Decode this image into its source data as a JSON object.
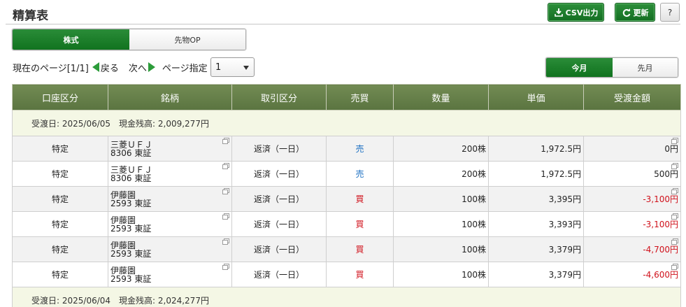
{
  "page": {
    "title": "精算表"
  },
  "toolbar": {
    "csv_label": "CSV出力",
    "refresh_label": "更新",
    "help_label": "?"
  },
  "product_tabs": [
    {
      "label": "株式",
      "selected": true
    },
    {
      "label": "先物OP",
      "selected": false
    }
  ],
  "pager": {
    "current_page_label": "現在のページ[1/1]",
    "prev_label": "戻る",
    "next_label": "次へ",
    "page_select_label": "ページ指定",
    "page_value": "1"
  },
  "period_tabs": [
    {
      "label": "今月",
      "selected": true
    },
    {
      "label": "先月",
      "selected": false
    }
  ],
  "colors": {
    "header": "#65804a",
    "sell": "#1b6fc2",
    "buy": "#d0111b",
    "negative": "#d0111b",
    "accent": "#1e7d2b"
  },
  "table": {
    "headers": [
      "口座区分",
      "銘柄",
      "取引区分",
      "売買",
      "数量",
      "単価",
      "受渡金額"
    ],
    "group1": {
      "label": "受渡日: 2025/06/05　現金残高: 2,009,277円"
    },
    "rows": [
      {
        "account": "特定",
        "name": "三菱ＵＦＪ",
        "code": "8306 東証",
        "type": "返済（一日）",
        "side": "売",
        "qty": "200株",
        "price": "1,972.5円",
        "amount": "0円"
      },
      {
        "account": "特定",
        "name": "三菱ＵＦＪ",
        "code": "8306 東証",
        "type": "返済（一日）",
        "side": "売",
        "qty": "200株",
        "price": "1,972.5円",
        "amount": "500円"
      },
      {
        "account": "特定",
        "name": "伊藤園",
        "code": "2593 東証",
        "type": "返済（一日）",
        "side": "買",
        "qty": "100株",
        "price": "3,395円",
        "amount": "-3,100円"
      },
      {
        "account": "特定",
        "name": "伊藤園",
        "code": "2593 東証",
        "type": "返済（一日）",
        "side": "買",
        "qty": "100株",
        "price": "3,393円",
        "amount": "-3,100円"
      },
      {
        "account": "特定",
        "name": "伊藤園",
        "code": "2593 東証",
        "type": "返済（一日）",
        "side": "買",
        "qty": "100株",
        "price": "3,379円",
        "amount": "-4,700円"
      },
      {
        "account": "特定",
        "name": "伊藤園",
        "code": "2593 東証",
        "type": "返済（一日）",
        "side": "買",
        "qty": "100株",
        "price": "3,379円",
        "amount": "-4,600円"
      }
    ],
    "group2": {
      "label": "受渡日: 2025/06/04　現金残高: 2,024,277円"
    }
  }
}
